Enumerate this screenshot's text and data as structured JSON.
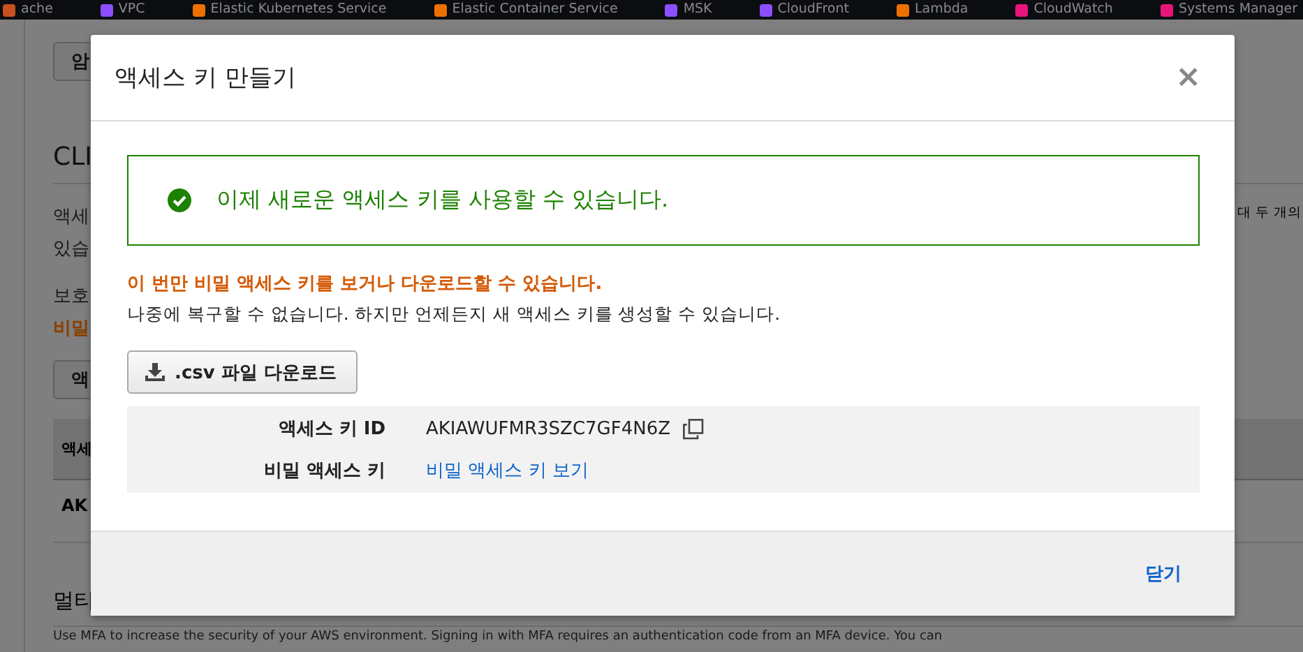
{
  "nav_bar": {
    "items": [
      {
        "label": "ache",
        "color": "#c7511f"
      },
      {
        "label": "VPC",
        "color": "#8c4fff"
      },
      {
        "label": "Elastic Kubernetes Service",
        "color": "#ed7100"
      },
      {
        "label": "Elastic Container Service",
        "color": "#ed7100"
      },
      {
        "label": "MSK",
        "color": "#8c4fff"
      },
      {
        "label": "CloudFront",
        "color": "#8c4fff"
      },
      {
        "label": "Lambda",
        "color": "#ed7100"
      },
      {
        "label": "CloudWatch",
        "color": "#e7157b"
      },
      {
        "label": "Systems Manager",
        "color": "#e7157b"
      }
    ]
  },
  "background_page": {
    "top_button": "암",
    "heading": "CLI",
    "paragraph_lines": [
      "액세",
      "있습"
    ],
    "paragraph_right": "대 두 개의",
    "protect_text": "보호",
    "secret_warning": "비밀",
    "action_button": "액",
    "table_header": "액세",
    "table_cell": "AK",
    "mfa_heading": "멀티",
    "mfa_text": "Use MFA to increase the security of your AWS environment. Signing in with MFA requires an authentication code from an MFA device. You can"
  },
  "dialog": {
    "title": "액세스 키 만들기",
    "close": "×",
    "success_message": "이제 새로운 액세스 키를 사용할 수 있습니다.",
    "warning": "이 번만 비밀 액세스 키를 보거나 다운로드할 수 있습니다.",
    "note": "나중에 복구할 수 없습니다. 하지만 언제든지 새 액세스 키를 생성할 수 있습니다.",
    "download_button": ".csv 파일 다운로드",
    "fields": [
      {
        "label": "액세스 키 ID",
        "value": "AKIAWUFMR3SZC7GF4N6Z",
        "kind": "copyable"
      },
      {
        "label": "비밀 액세스 키",
        "value": "비밀 액세스 키 보기",
        "kind": "link"
      }
    ],
    "close_button": "닫기"
  }
}
